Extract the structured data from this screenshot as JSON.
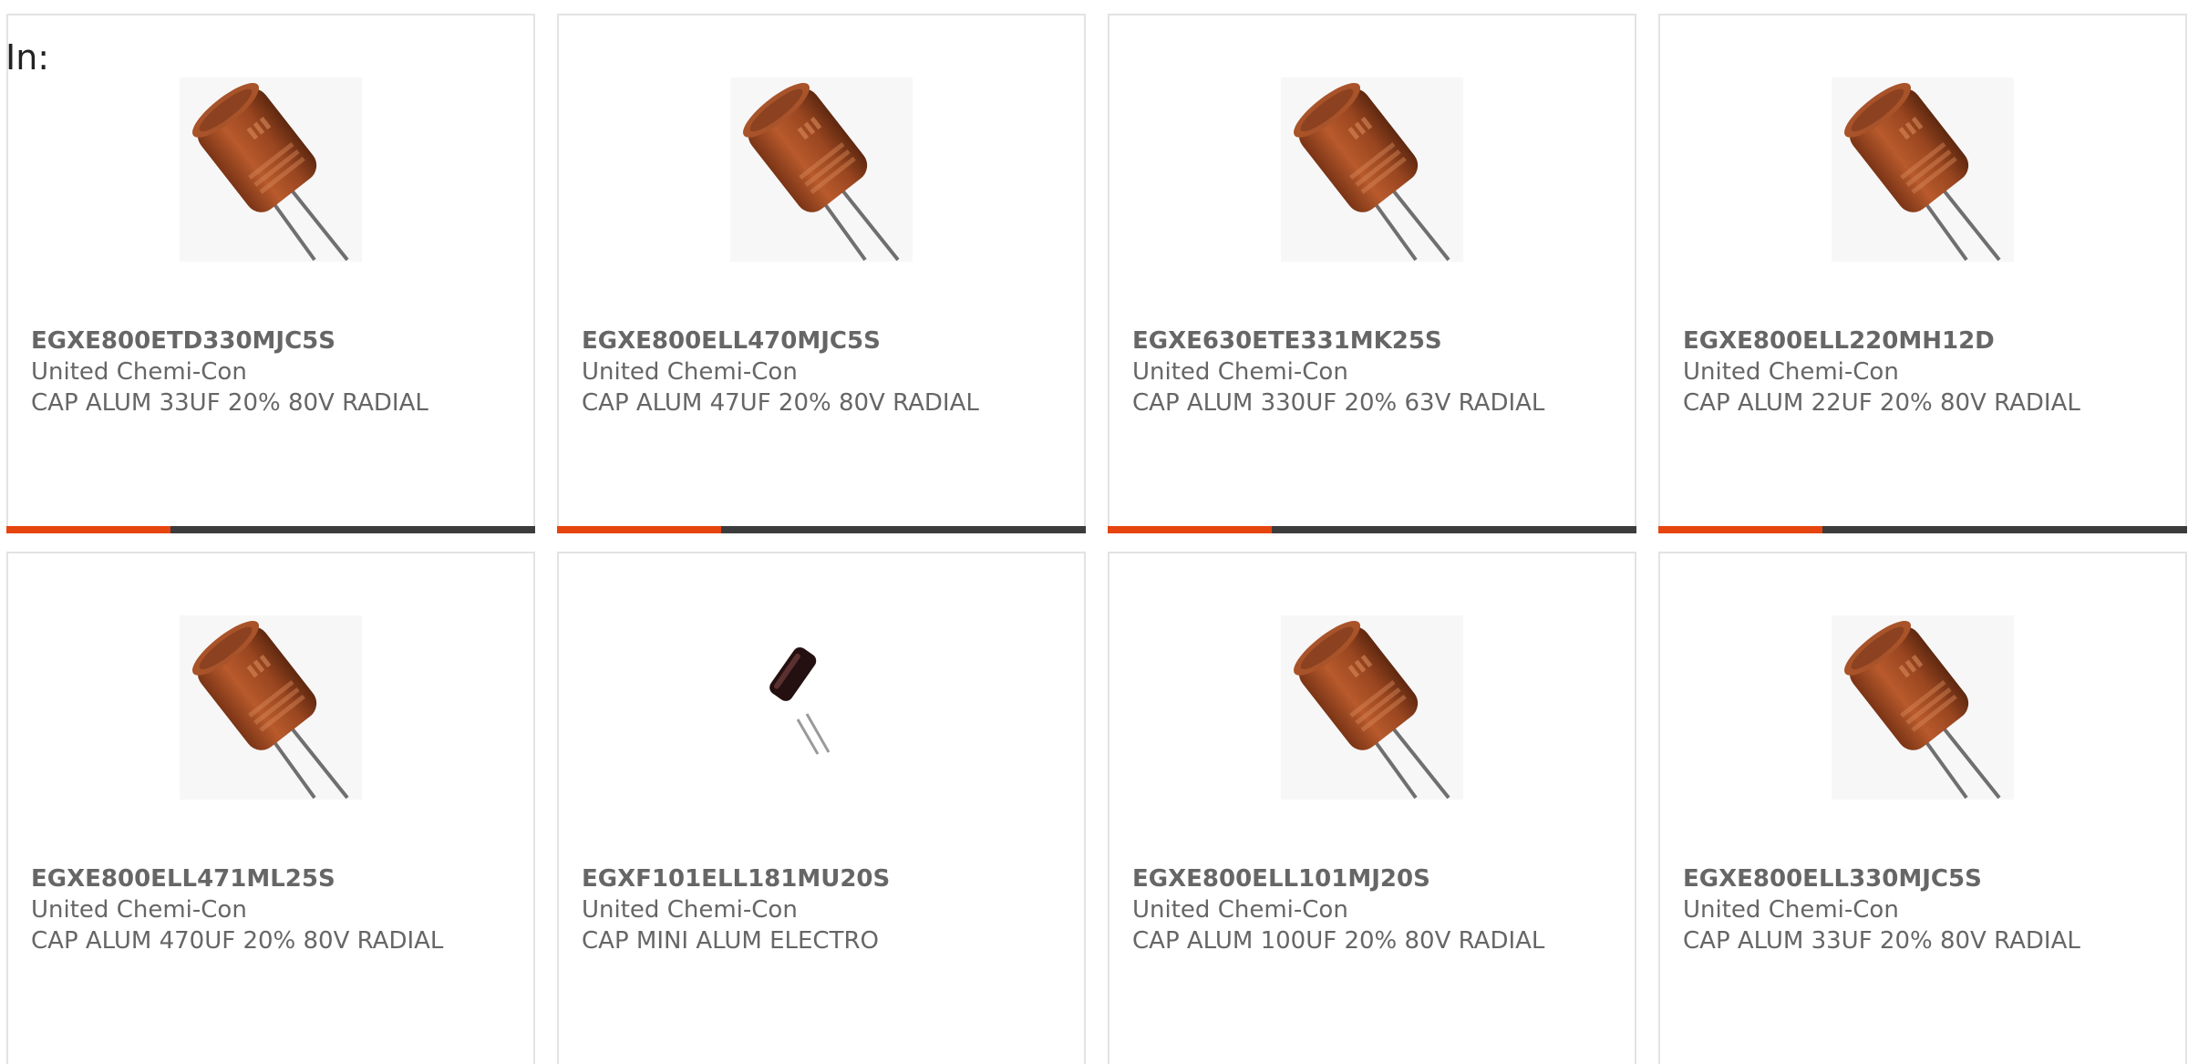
{
  "header": {
    "label": "In:"
  },
  "colors": {
    "accent": "#e64510",
    "track": "#3c3c3c",
    "text": "#666666"
  },
  "products": [
    {
      "part_number": "EGXE800ETD330MJC5S",
      "manufacturer": "United Chemi-Con",
      "description": "CAP ALUM 33UF 20% 80V RADIAL",
      "image": "radial-capacitor-brown",
      "progress": 0.31
    },
    {
      "part_number": "EGXE800ELL470MJC5S",
      "manufacturer": "United Chemi-Con",
      "description": "CAP ALUM 47UF 20% 80V RADIAL",
      "image": "radial-capacitor-brown",
      "progress": 0.31
    },
    {
      "part_number": "EGXE630ETE331MK25S",
      "manufacturer": "United Chemi-Con",
      "description": "CAP ALUM 330UF 20% 63V RADIAL",
      "image": "radial-capacitor-brown",
      "progress": 0.31
    },
    {
      "part_number": "EGXE800ELL220MH12D",
      "manufacturer": "United Chemi-Con",
      "description": "CAP ALUM 22UF 20% 80V RADIAL",
      "image": "radial-capacitor-brown",
      "progress": 0.31
    },
    {
      "part_number": "EGXE800ELL471ML25S",
      "manufacturer": "United Chemi-Con",
      "description": "CAP ALUM 470UF 20% 80V RADIAL",
      "image": "radial-capacitor-brown"
    },
    {
      "part_number": "EGXF101ELL181MU20S",
      "manufacturer": "United Chemi-Con",
      "description": "CAP MINI ALUM ELECTRO",
      "image": "mini-capacitor-black"
    },
    {
      "part_number": "EGXE800ELL101MJ20S",
      "manufacturer": "United Chemi-Con",
      "description": "CAP ALUM 100UF 20% 80V RADIAL",
      "image": "radial-capacitor-brown"
    },
    {
      "part_number": "EGXE800ELL330MJC5S",
      "manufacturer": "United Chemi-Con",
      "description": "CAP ALUM 33UF 20% 80V RADIAL",
      "image": "radial-capacitor-brown"
    }
  ]
}
